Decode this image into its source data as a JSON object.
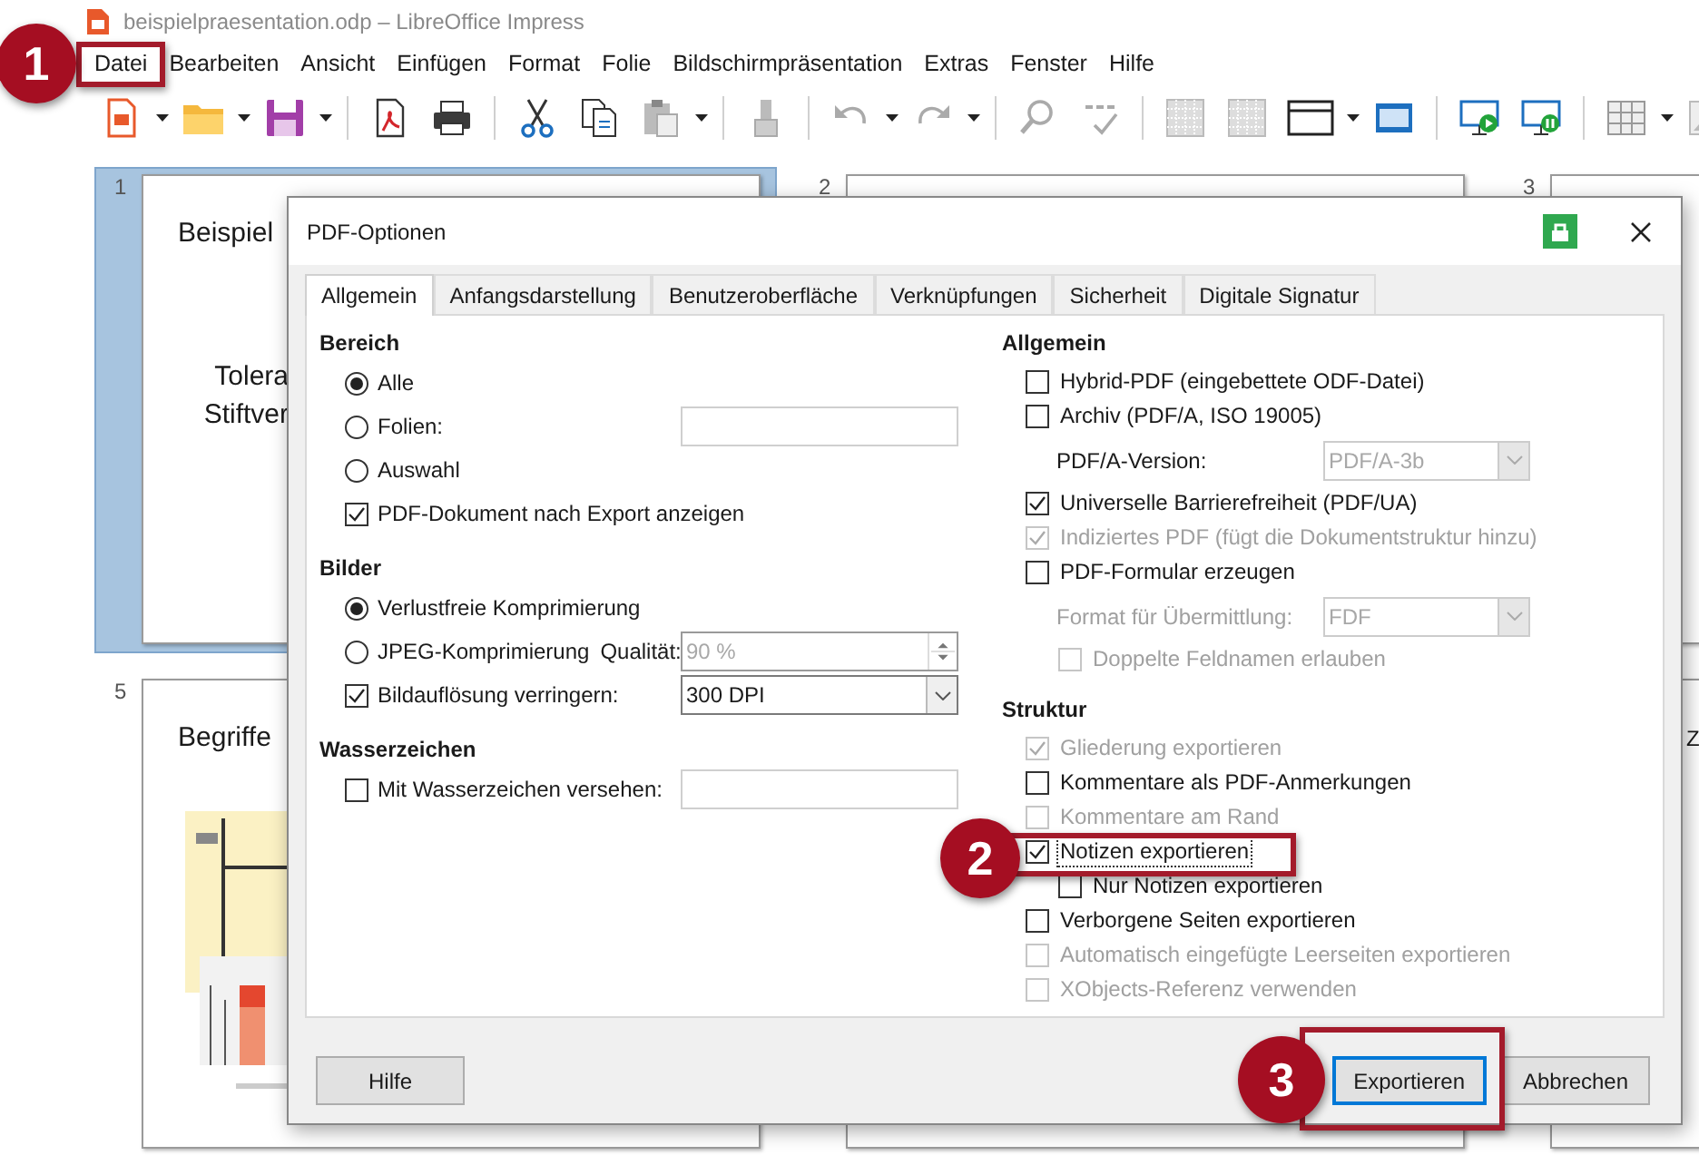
{
  "window": {
    "title": "beispielpraesentation.odp – LibreOffice Impress"
  },
  "menu": [
    {
      "label": "Datei"
    },
    {
      "label": "Bearbeiten"
    },
    {
      "label": "Ansicht"
    },
    {
      "label": "Einfügen"
    },
    {
      "label": "Format"
    },
    {
      "label": "Folie"
    },
    {
      "label": "Bildschirmpräsentation"
    },
    {
      "label": "Extras"
    },
    {
      "label": "Fenster"
    },
    {
      "label": "Hilfe"
    }
  ],
  "slides": [
    {
      "number": "1",
      "selected": true,
      "title": "Beispiel",
      "lines": [
        "Tolera",
        "Stiftver"
      ]
    },
    {
      "number": "2",
      "selected": false
    },
    {
      "number": "3",
      "selected": false
    },
    {
      "number": "5",
      "selected": false,
      "title": "Begriffe",
      "kind": "picture"
    },
    {
      "selected": false
    },
    {
      "selected": false,
      "title": "Z"
    }
  ],
  "dialog": {
    "title": "PDF-Optionen",
    "tabs": [
      {
        "label": "Allgemein",
        "selected": true
      },
      {
        "label": "Anfangsdarstellung",
        "selected": false
      },
      {
        "label": "Benutzeroberfläche",
        "selected": false
      },
      {
        "label": "Verknüpfungen",
        "selected": false
      },
      {
        "label": "Sicherheit",
        "selected": false
      },
      {
        "label": "Digitale Signatur",
        "selected": false
      }
    ],
    "left": [
      {
        "heading": "Bereich",
        "items": [
          {
            "kind": "radio",
            "label": "Alle",
            "selected": true
          },
          {
            "kind": "radio",
            "label": "Folien:",
            "selected": false,
            "field": {
              "kind": "text-field"
            }
          },
          {
            "kind": "radio",
            "label": "Auswahl",
            "selected": false
          },
          {
            "kind": "checkbox",
            "label": "PDF-Dokument nach Export anzeigen",
            "checked": true
          }
        ]
      },
      {
        "heading": "Bilder",
        "items": [
          {
            "kind": "radio",
            "label": "Verlustfreie Komprimierung",
            "selected": true
          },
          {
            "kind": "radio",
            "label": "JPEG-Komprimierung",
            "selected": false,
            "sublabel": "Qualität:",
            "field": {
              "kind": "spin",
              "value": "90 %",
              "disabled": true
            }
          },
          {
            "kind": "checkbox",
            "label": "Bildauflösung verringern:",
            "checked": true,
            "field": {
              "kind": "dropdown",
              "value": "300 DPI",
              "disabled": false
            }
          }
        ]
      },
      {
        "heading": "Wasserzeichen",
        "items": [
          {
            "kind": "checkbox",
            "label": "Mit Wasserzeichen versehen:",
            "checked": false,
            "field": {
              "kind": "text-field"
            }
          }
        ]
      }
    ],
    "right": [
      {
        "heading": "Allgemein",
        "items": [
          {
            "kind": "checkbox",
            "label": "Hybrid-PDF (eingebettete ODF-Datei)",
            "checked": false,
            "disabled": false
          },
          {
            "kind": "checkbox",
            "label": "Archiv (PDF/A, ISO 19005)",
            "checked": false,
            "disabled": false,
            "children": [
              {
                "kind": "dropdown",
                "label": "PDF/A-Version:",
                "value": "PDF/A-3b",
                "disabled": false,
                "control_disabled": true
              }
            ]
          },
          {
            "kind": "checkbox",
            "label": "Universelle Barrierefreiheit (PDF/UA)",
            "checked": true,
            "disabled": false
          },
          {
            "kind": "checkbox",
            "label": "Indiziertes PDF (fügt die Dokumentstruktur hinzu)",
            "checked": true,
            "disabled": true
          },
          {
            "kind": "checkbox",
            "label": "PDF-Formular erzeugen",
            "checked": false,
            "disabled": false,
            "children": [
              {
                "kind": "dropdown",
                "label": "Format für Übermittlung:",
                "value": "FDF",
                "disabled": true,
                "control_disabled": true
              },
              {
                "kind": "checkbox",
                "label": "Doppelte Feldnamen erlauben",
                "checked": false,
                "disabled": true
              }
            ]
          }
        ]
      },
      {
        "heading": "Struktur",
        "items": [
          {
            "kind": "checkbox",
            "label": "Gliederung exportieren",
            "checked": true,
            "disabled": true,
            "focused": false
          },
          {
            "kind": "checkbox",
            "label": "Kommentare als PDF-Anmerkungen",
            "checked": false,
            "disabled": false,
            "focused": false
          },
          {
            "kind": "checkbox",
            "label": "Kommentare am Rand",
            "checked": false,
            "disabled": true,
            "focused": false
          },
          {
            "kind": "checkbox",
            "label": "Notizen exportieren",
            "checked": true,
            "disabled": false,
            "focused": true,
            "children": [
              {
                "kind": "checkbox",
                "label": "Nur Notizen exportieren",
                "checked": false,
                "disabled": false
              }
            ]
          },
          {
            "kind": "checkbox",
            "label": "Verborgene Seiten exportieren",
            "checked": false,
            "disabled": false,
            "focused": false
          },
          {
            "kind": "checkbox",
            "label": "Automatisch eingefügte Leerseiten exportieren",
            "checked": false,
            "disabled": true,
            "focused": false
          },
          {
            "kind": "checkbox",
            "label": "XObjects-Referenz verwenden",
            "checked": false,
            "disabled": true,
            "focused": false
          }
        ]
      }
    ],
    "buttons": [
      {
        "label": "Hilfe",
        "default": false
      },
      {
        "label": "Exportieren",
        "default": true
      },
      {
        "label": "Abbrechen",
        "default": false
      }
    ]
  },
  "annotations": [
    {
      "label": "1"
    },
    {
      "label": "2"
    },
    {
      "label": "3"
    }
  ]
}
